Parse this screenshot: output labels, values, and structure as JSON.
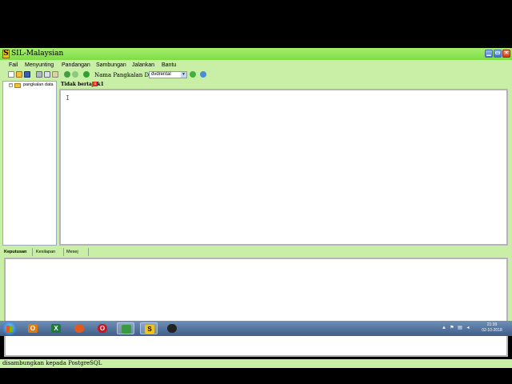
{
  "window": {
    "title": "SIL-Malaysian",
    "icon_letter": "S",
    "controls": {
      "minimize": "▁",
      "maximize": "▭",
      "close": "×"
    }
  },
  "menu": {
    "items": [
      "Fail",
      "Menyunting",
      "Pandangan",
      "Sambungan",
      "Jalankan",
      "Bantu"
    ]
  },
  "toolbar": {
    "icons": [
      "new-file-icon",
      "open-folder-icon",
      "save-icon",
      "cut-icon",
      "copy-icon",
      "paste-icon",
      "undo-icon",
      "redo-icon",
      "run-icon"
    ],
    "db_label": "Nama Pangkalan Data",
    "db_selected": "dvdrental",
    "refresh_icon": "refresh-icon",
    "connect_icon": "globe-icon"
  },
  "tree": {
    "expander": "−",
    "root_label": "pangkalan data"
  },
  "editor": {
    "tab_label": "Tidak bertajuk1",
    "tab_close": "x",
    "cursor": "I"
  },
  "lower_tabs": [
    "Keputusan",
    "Kesilapan",
    "Mesej"
  ],
  "status": {
    "text": "disambungkan kepada   PostgreSQL"
  },
  "taskbar": {
    "apps": [
      "outlook",
      "firefox",
      "excel",
      "opera",
      "chart-tool",
      "sil-app",
      "obs"
    ],
    "clock_time": "21:39",
    "clock_date": "02-10-2018"
  },
  "colors": {
    "app_bg": "#c9efa7",
    "titlebar": "#7ddc45",
    "taskbar": "#3f5f8a"
  }
}
